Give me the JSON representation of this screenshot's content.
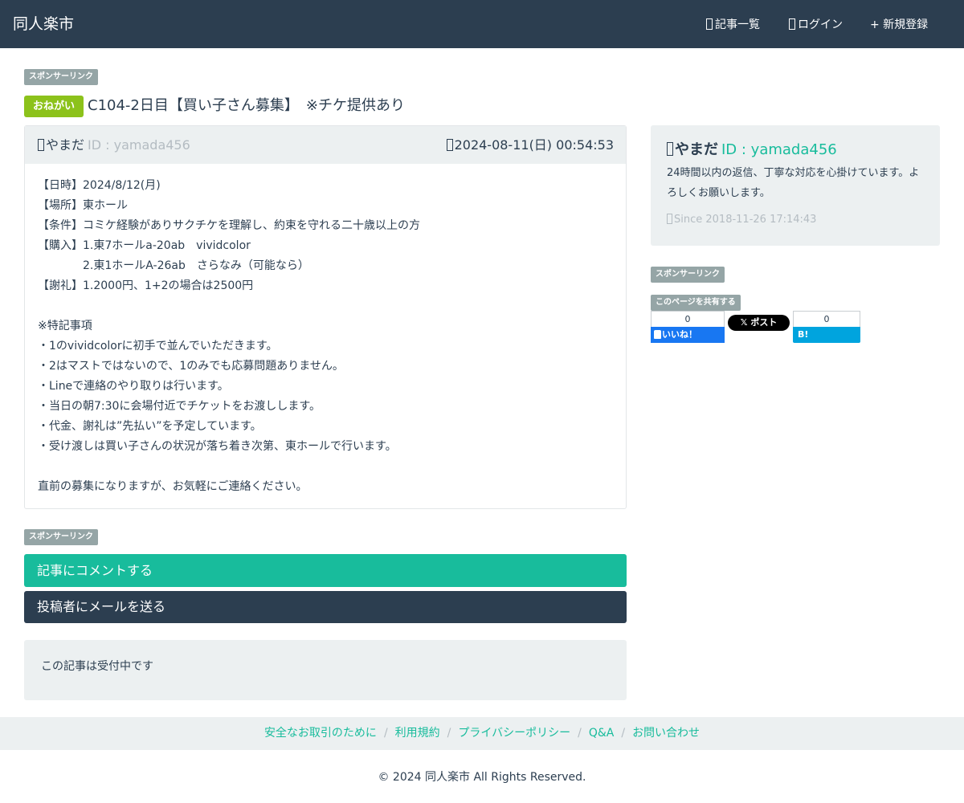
{
  "navbar": {
    "brand": "同人楽市",
    "items": [
      {
        "label": "記事一覧",
        "icon": "list-icon"
      },
      {
        "label": "ログイン",
        "icon": "login-icon"
      },
      {
        "label": "+ 新規登録"
      }
    ]
  },
  "sponsor_label": "スポンサーリンク",
  "post": {
    "badge": "おねがい",
    "title": "C104-2日目【買い子さん募集】　※チケ提供あり",
    "author_name": "やまだ",
    "author_id": "ID : yamada456",
    "datetime": "2024-08-11(日) 00:54:53",
    "body_lines": [
      "【日時】2024/8/12(月)",
      "【場所】東ホール",
      "【条件】コミケ経験がありサクチケを理解し、約束を守れる二十歳以上の方",
      "【購入】1.東7ホールa-20ab　vividcolor",
      "　　　　2.東1ホールA-26ab　さらなみ（可能なら）",
      "【謝礼】1.2000円、1+2の場合は2500円",
      "",
      "※特記事項",
      "・1のvividcolorに初手で並んでいただきます。",
      "・2はマストではないので、1のみでも応募問題ありません。",
      "・Lineで連絡のやり取りは行います。",
      "・当日の朝7:30に会場付近でチケットをお渡しします。",
      "・代金、謝礼は”先払い”を予定しています。",
      "・受け渡しは買い子さんの状況が落ち着き次第、東ホールで行います。",
      "",
      "直前の募集になりますが、お気軽にご連絡ください。"
    ]
  },
  "actions": {
    "comment": "記事にコメントする",
    "mail": "投稿者にメールを送る"
  },
  "status": "この記事は受付中です",
  "profile": {
    "name": "やまだ",
    "id": "ID : yamada456",
    "description": "24時間以内の返信、丁寧な対応を心掛けています。よろしくお願いします。",
    "since": "Since 2018-11-26 17:14:43"
  },
  "share": {
    "label": "このページを共有する",
    "fb_count": "0",
    "fb_label": "いいね！",
    "x_label": "𝕏 ポスト",
    "hb_count": "0",
    "hb_label": "B! Bookmark"
  },
  "footer": {
    "links": [
      "安全なお取引のために",
      "利用規約",
      "プライバシーポリシー",
      "Q&A",
      "お問い合わせ"
    ],
    "separator": "/",
    "copyright": "© 2024 同人楽市 All Rights Reserved."
  },
  "colors": {
    "navbar": "#2c3e50",
    "accent": "#18bc9c",
    "badge_green": "#8cc21b",
    "badge_gray": "#95a5a6",
    "well": "#ecf0f1"
  }
}
